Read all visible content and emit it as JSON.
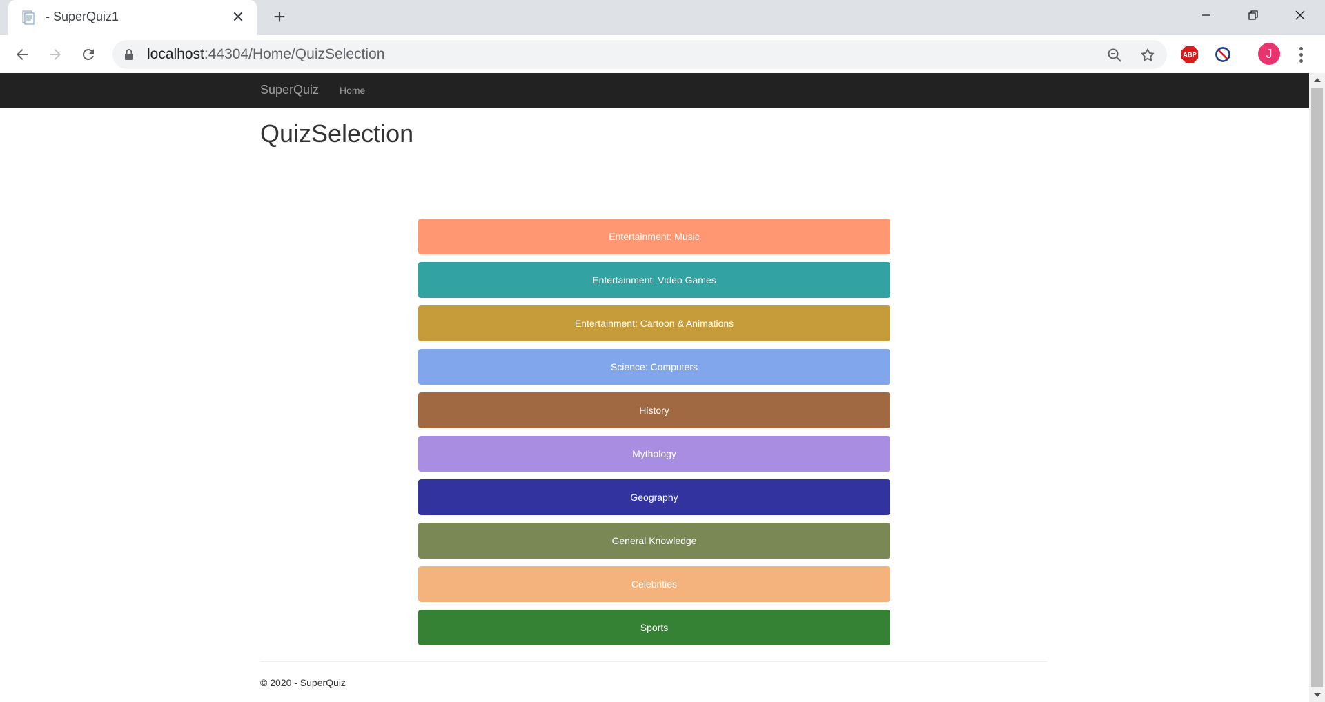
{
  "browser": {
    "tab_title": "- SuperQuiz1",
    "new_tab_label": "+",
    "url_host": "localhost",
    "url_rest": ":44304/Home/QuizSelection",
    "profile_initial": "J"
  },
  "navbar": {
    "brand": "SuperQuiz",
    "home_link": "Home"
  },
  "page": {
    "title": "QuizSelection"
  },
  "quizzes": [
    {
      "label": "Entertainment: Music",
      "color": "#ff9872"
    },
    {
      "label": "Entertainment: Video Games",
      "color": "#32a2a2"
    },
    {
      "label": "Entertainment: Cartoon & Animations",
      "color": "#c69c3b"
    },
    {
      "label": "Science: Computers",
      "color": "#82a6eb"
    },
    {
      "label": "History",
      "color": "#a06942"
    },
    {
      "label": "Mythology",
      "color": "#a88de0"
    },
    {
      "label": "Geography",
      "color": "#3333a0"
    },
    {
      "label": "General Knowledge",
      "color": "#7a8856"
    },
    {
      "label": "Celebrities",
      "color": "#f4b37d"
    },
    {
      "label": "Sports",
      "color": "#358235"
    }
  ],
  "footer": {
    "text": "© 2020 - SuperQuiz"
  }
}
